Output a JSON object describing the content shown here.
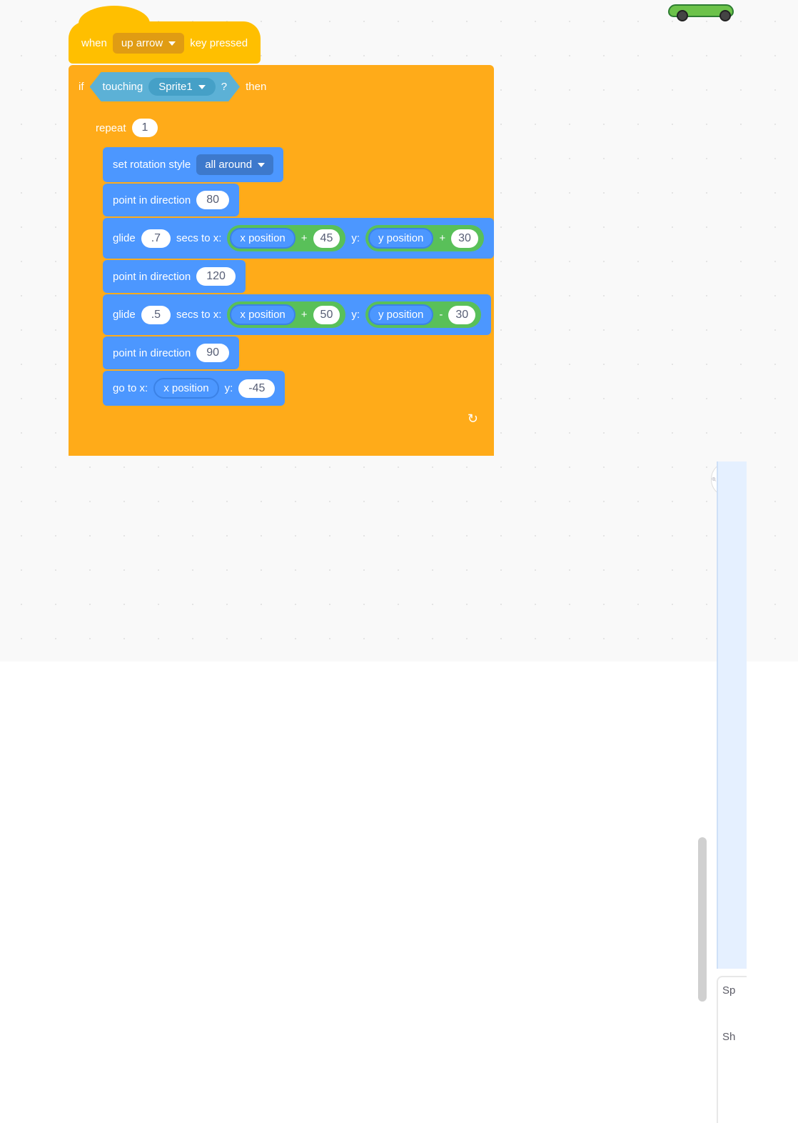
{
  "hat": {
    "when": "when",
    "key": "up arrow",
    "pressed": "key pressed"
  },
  "if_block": {
    "if": "if",
    "then": "then",
    "touching": "touching",
    "target": "Sprite1",
    "q": "?"
  },
  "repeat": {
    "label": "repeat",
    "count": "1"
  },
  "rot": {
    "label": "set rotation style",
    "value": "all around"
  },
  "point1": {
    "label": "point in direction",
    "value": "80"
  },
  "glide1": {
    "glide": "glide",
    "secs_to_x": "secs to x:",
    "y": "y:",
    "val_secs": ".7",
    "op1_a": "x position",
    "op1_sign": "+",
    "op1_b": "45",
    "op2_a": "y position",
    "op2_sign": "+",
    "op2_b": "30"
  },
  "point2": {
    "label": "point in direction",
    "value": "120"
  },
  "glide2": {
    "glide": "glide",
    "secs_to_x": "secs to x:",
    "y": "y:",
    "val_secs": ".5",
    "op1_a": "x position",
    "op1_sign": "+",
    "op1_b": "50",
    "op2_a": "y position",
    "op2_sign": "-",
    "op2_b": "30"
  },
  "point3": {
    "label": "point in direction",
    "value": "90"
  },
  "goto": {
    "label": "go to x:",
    "y": "y:",
    "xval": "x position",
    "yval": "-45"
  },
  "right": {
    "sp": "Sp",
    "sh": "Sh"
  },
  "colors": {
    "events": "#ffbf00",
    "control": "#ffab19",
    "motion": "#4c97ff",
    "sensing": "#5cb1d6",
    "operators": "#59c059"
  }
}
